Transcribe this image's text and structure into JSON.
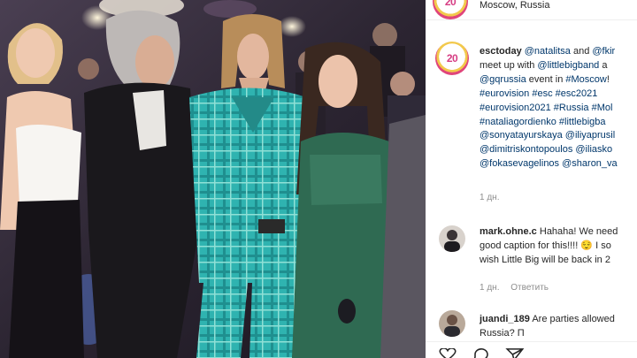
{
  "post": {
    "location": "Moscow, Russia",
    "caption": {
      "username": "esctoday",
      "lines": [
        {
          "parts": [
            {
              "t": "link",
              "v": "@natalitsa"
            },
            {
              "t": "txt",
              "v": " and "
            },
            {
              "t": "link",
              "v": "@fkir"
            }
          ]
        },
        {
          "parts": [
            {
              "t": "txt",
              "v": "meet up with "
            },
            {
              "t": "link",
              "v": "@littlebigband"
            },
            {
              "t": "txt",
              "v": " a"
            }
          ]
        },
        {
          "parts": [
            {
              "t": "link",
              "v": "@gqrussia"
            },
            {
              "t": "txt",
              "v": " event in "
            },
            {
              "t": "link",
              "v": "#Moscow"
            },
            {
              "t": "txt",
              "v": "!"
            }
          ]
        },
        {
          "parts": [
            {
              "t": "link",
              "v": "#eurovision"
            },
            {
              "t": "txt",
              "v": " "
            },
            {
              "t": "link",
              "v": "#esc"
            },
            {
              "t": "txt",
              "v": " "
            },
            {
              "t": "link",
              "v": "#esc2021"
            }
          ]
        },
        {
          "parts": [
            {
              "t": "link",
              "v": "#eurovision2021"
            },
            {
              "t": "txt",
              "v": " "
            },
            {
              "t": "link",
              "v": "#Russia"
            },
            {
              "t": "txt",
              "v": " "
            },
            {
              "t": "link",
              "v": "#Mol"
            }
          ]
        },
        {
          "parts": [
            {
              "t": "link",
              "v": "#nataliagordienko"
            },
            {
              "t": "txt",
              "v": " "
            },
            {
              "t": "link",
              "v": "#littlebigba"
            }
          ]
        },
        {
          "parts": [
            {
              "t": "link",
              "v": "@sonyatayurskaya"
            },
            {
              "t": "txt",
              "v": " "
            },
            {
              "t": "link",
              "v": "@iliyaprusil"
            }
          ]
        },
        {
          "parts": [
            {
              "t": "link",
              "v": "@dimitriskontopoulos"
            },
            {
              "t": "txt",
              "v": " "
            },
            {
              "t": "link",
              "v": "@iliasko"
            }
          ]
        },
        {
          "parts": [
            {
              "t": "link",
              "v": "@fokasevagelinos"
            },
            {
              "t": "txt",
              "v": " "
            },
            {
              "t": "link",
              "v": "@sharon_va"
            }
          ]
        }
      ],
      "time": "1 дн."
    },
    "brand_avatar_text": "20",
    "comments": [
      {
        "username": "mark.ohne.c",
        "lines": [
          "Hahaha! We need",
          "good caption for this!!!! 😌 I so",
          "wish Little Big will be back in 2"
        ],
        "first_line_prefix": " ",
        "time": "1 дн.",
        "reply": "Ответить"
      },
      {
        "username": "juandi_189",
        "lines": [
          "Are parties allowed",
          "Russia? П"
        ],
        "first_line_prefix": " "
      }
    ],
    "colors": {
      "link": "#00376b",
      "muted": "#8e8e8e",
      "brand_pink": "#e0457b",
      "brand_yellow": "#f2c94c",
      "suit_teal": "#2fb3b0"
    },
    "icons": [
      "heart-icon",
      "comment-icon",
      "share-icon"
    ]
  }
}
